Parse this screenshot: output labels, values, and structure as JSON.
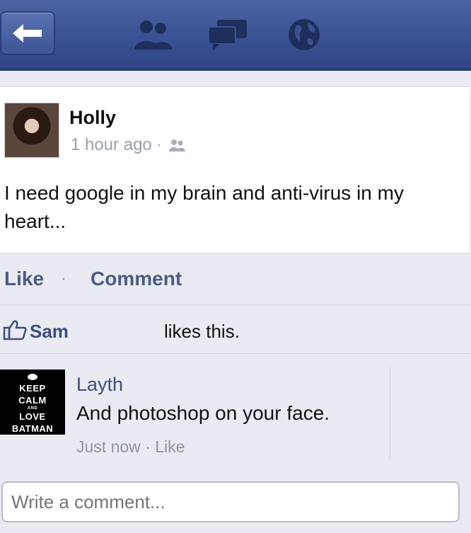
{
  "nav": {
    "back_icon": "back-arrow-icon",
    "icons": [
      "friends-icon",
      "messages-icon",
      "globe-icon"
    ],
    "bar_color": "#3a5293"
  },
  "post": {
    "author": "Holly",
    "time": "1 hour ago",
    "separator": "·",
    "privacy_icon": "friends-icon",
    "text": "I need google in my brain and anti-virus in my heart..."
  },
  "actions": {
    "like": "Like",
    "separator": "·",
    "comment": "Comment"
  },
  "likes": {
    "name": "Sam",
    "suffix": "likes this."
  },
  "comment": {
    "avatar_lines": [
      "KEEP",
      "CALM",
      "AND",
      "LOVE",
      "BATMAN"
    ],
    "author": "Layth",
    "text": "And photoshop on your face.",
    "time": "Just now",
    "separator": "·",
    "like": "Like"
  },
  "input": {
    "placeholder": "Write a comment..."
  }
}
